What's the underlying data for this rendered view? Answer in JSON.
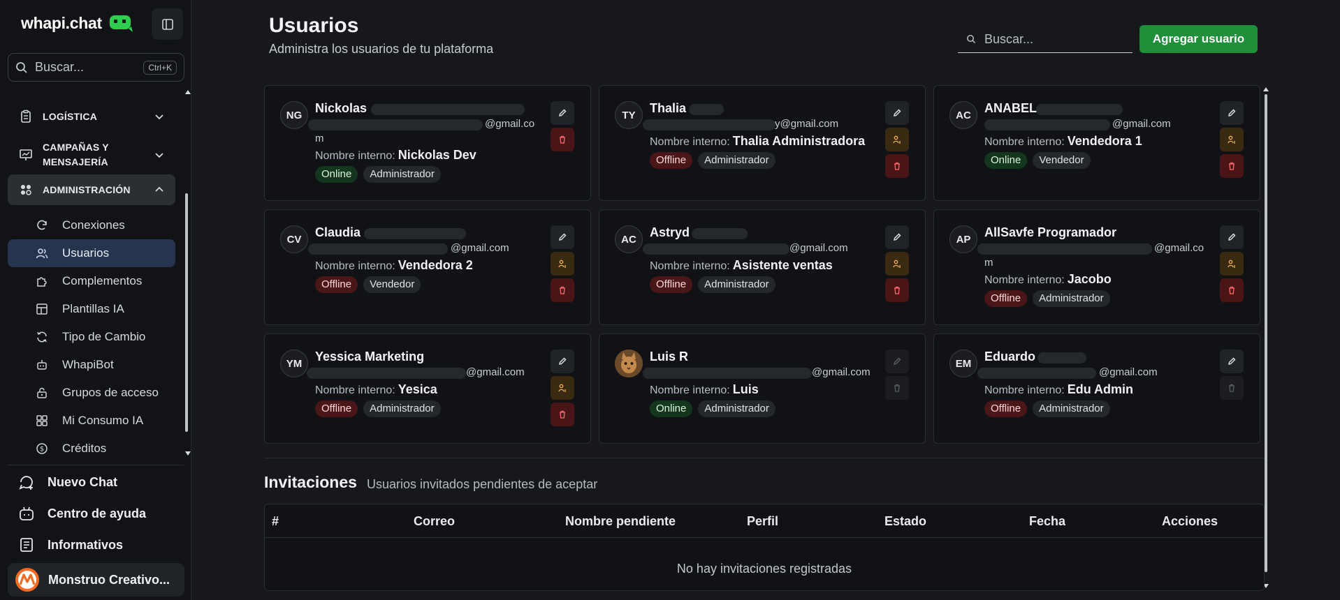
{
  "sidebar": {
    "brand": "whapi.chat",
    "search_placeholder": "Buscar...",
    "search_shortcut": "Ctrl+K",
    "groups": [
      {
        "label": "LOGÍSTICA",
        "icon": "clipboard-icon"
      },
      {
        "label": "CAMPAÑAS Y MENSAJERÍA",
        "icon": "presentation-icon"
      },
      {
        "label": "ADMINISTRACIÓN",
        "icon": "grid-icon"
      }
    ],
    "items": [
      {
        "label": "Conexiones",
        "icon": "refresh-icon"
      },
      {
        "label": "Usuarios",
        "icon": "users-icon"
      },
      {
        "label": "Complementos",
        "icon": "puzzle-icon"
      },
      {
        "label": "Plantillas IA",
        "icon": "template-icon"
      },
      {
        "label": "Tipo de Cambio",
        "icon": "exchange-icon"
      },
      {
        "label": "WhapiBot",
        "icon": "bot-icon"
      },
      {
        "label": "Grupos de acceso",
        "icon": "lock-icon"
      },
      {
        "label": "Mi Consumo IA",
        "icon": "dashboard-icon"
      },
      {
        "label": "Créditos",
        "icon": "dollar-icon"
      }
    ],
    "bottom_links": [
      {
        "label": "Nuevo Chat",
        "icon": "chat-plus-icon"
      },
      {
        "label": "Centro de ayuda",
        "icon": "help-bot-icon"
      },
      {
        "label": "Informativos",
        "icon": "newspaper-icon"
      }
    ],
    "account": "Monstruo Creativo..."
  },
  "header": {
    "title": "Usuarios",
    "subtitle": "Administra los usuarios de tu plataforma",
    "search_placeholder": "Buscar...",
    "add_button": "Agregar usuario"
  },
  "internal_label": "Nombre interno:",
  "users": [
    {
      "initials": "NG",
      "name": "Nickolas",
      "email_tail": "@gmail.co",
      "email_wrap": "m",
      "internal": "Nickolas Dev",
      "status": "Online",
      "role": "Administrador"
    },
    {
      "initials": "TY",
      "name": "Thalia",
      "email_tail": "y@gmail.com",
      "internal": "Thalia Administradora",
      "status": "Offline",
      "role": "Administrador"
    },
    {
      "initials": "AC",
      "name": "ANABEL",
      "email_tail": "@gmail.com",
      "internal": "Vendedora 1",
      "status": "Online",
      "role": "Vendedor"
    },
    {
      "initials": "CV",
      "name": "Claudia",
      "email_tail": "@gmail.com",
      "internal": "Vendedora 2",
      "status": "Offline",
      "role": "Vendedor"
    },
    {
      "initials": "AC",
      "name": "Astryd",
      "email_tail": "@gmail.com",
      "internal": "Asistente ventas",
      "status": "Offline",
      "role": "Administrador"
    },
    {
      "initials": "AP",
      "name": "AllSavfe Programador",
      "email_tail": "@gmail.co",
      "email_wrap": "m",
      "internal": "Jacobo",
      "status": "Offline",
      "role": "Administrador"
    },
    {
      "initials": "YM",
      "name": "Yessica Marketing",
      "email_tail": "@gmail.com",
      "internal": "Yesica",
      "status": "Offline",
      "role": "Administrador"
    },
    {
      "initials": "",
      "name": "Luis R",
      "email_tail": "@gmail.com",
      "internal": "Luis",
      "status": "Online",
      "role": "Administrador"
    },
    {
      "initials": "EM",
      "name": "Eduardo",
      "email_tail": "@gmail.com",
      "internal": "Edu Admin",
      "status": "Offline",
      "role": "Administrador"
    }
  ],
  "invitations": {
    "title": "Invitaciones",
    "subtitle": "Usuarios invitados pendientes de aceptar",
    "columns": [
      "#",
      "Correo",
      "Nombre pendiente",
      "Perfil",
      "Estado",
      "Fecha",
      "Acciones"
    ],
    "empty": "No hay invitaciones registradas"
  },
  "colors": {
    "accent_green": "#1f8f3a",
    "online_bg": "#14361f",
    "offline_bg": "#4a1618",
    "active_nav": "#26344d"
  }
}
